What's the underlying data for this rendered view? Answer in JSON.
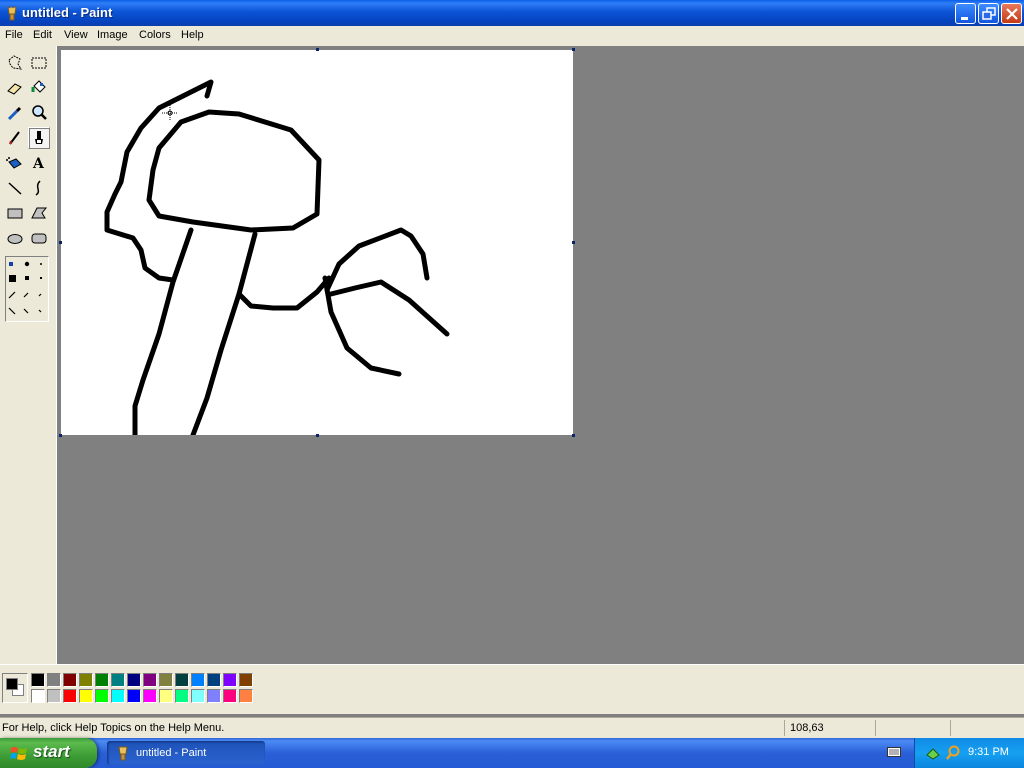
{
  "window": {
    "title": "untitled - Paint",
    "app_icon": "paint-icon",
    "controls": [
      "minimize-icon",
      "maximize-icon",
      "close-icon"
    ]
  },
  "menu": {
    "items": [
      "File",
      "Edit",
      "View",
      "Image",
      "Colors",
      "Help"
    ]
  },
  "toolbox": {
    "tools": [
      {
        "name": "free-form-select",
        "icon": "free-form-select-icon"
      },
      {
        "name": "select",
        "icon": "select-icon"
      },
      {
        "name": "eraser",
        "icon": "eraser-icon"
      },
      {
        "name": "fill-with-color",
        "icon": "fill-bucket-icon"
      },
      {
        "name": "pick-color",
        "icon": "eyedropper-icon"
      },
      {
        "name": "magnifier",
        "icon": "magnifier-icon"
      },
      {
        "name": "pencil",
        "icon": "pencil-icon"
      },
      {
        "name": "brush",
        "icon": "brush-icon",
        "active": true
      },
      {
        "name": "airbrush",
        "icon": "airbrush-icon"
      },
      {
        "name": "text",
        "icon": "text-icon"
      },
      {
        "name": "line",
        "icon": "line-icon"
      },
      {
        "name": "curve",
        "icon": "curve-icon"
      },
      {
        "name": "rectangle",
        "icon": "rectangle-icon"
      },
      {
        "name": "polygon",
        "icon": "polygon-icon"
      },
      {
        "name": "ellipse",
        "icon": "ellipse-icon"
      },
      {
        "name": "rounded-rectangle",
        "icon": "rounded-rectangle-icon"
      }
    ]
  },
  "palette": {
    "foreground": "#000000",
    "background": "#ffffff",
    "colors_top": [
      "#000000",
      "#808080",
      "#800000",
      "#808000",
      "#008000",
      "#008080",
      "#000080",
      "#800080",
      "#808040",
      "#004040",
      "#0080ff",
      "#004080",
      "#8000ff",
      "#804000"
    ],
    "colors_bottom": [
      "#ffffff",
      "#c0c0c0",
      "#ff0000",
      "#ffff00",
      "#00ff00",
      "#00ffff",
      "#0000ff",
      "#ff00ff",
      "#ffff80",
      "#00ff80",
      "#80ffff",
      "#8080ff",
      "#ff0080",
      "#ff8040"
    ]
  },
  "status": {
    "help_text": "For Help, click Help Topics on the Help Menu.",
    "coords": "108,63"
  },
  "taskbar": {
    "start_label": "start",
    "task_label": "untitled - Paint",
    "clock": "9:31 PM"
  }
}
